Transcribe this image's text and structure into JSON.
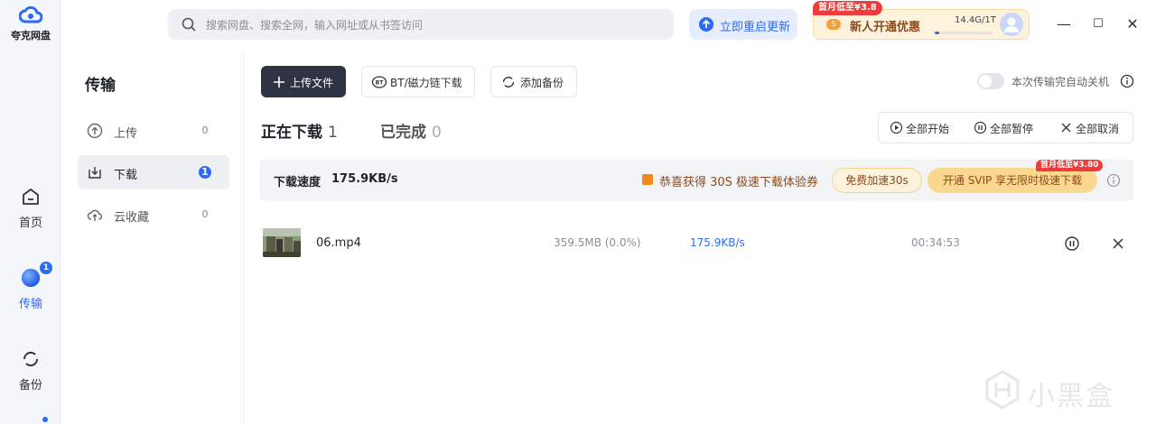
{
  "app": {
    "logo_text": "夸克网盘"
  },
  "rail": {
    "items": [
      {
        "label": "首页",
        "icon": "home-icon"
      },
      {
        "label": "传输",
        "icon": "transfer-icon",
        "badge": "1"
      },
      {
        "label": "备份",
        "icon": "backup-icon"
      }
    ]
  },
  "topbar": {
    "search_placeholder": "搜索网盘、搜索全网，输入网址或从书签访问",
    "restart_label": "立即重启更新",
    "promo_tag": "首月低至¥3.8",
    "promo_label": "新人开通优惠",
    "promo_coin": "S",
    "quota": "14.4G/1T",
    "quota_fraction": 0.0144
  },
  "window_controls": [
    "—",
    "☐",
    "✕"
  ],
  "side": {
    "title": "传输",
    "items": [
      {
        "label": "上传",
        "count": "0"
      },
      {
        "label": "下载",
        "count": "1"
      },
      {
        "label": "云收藏",
        "count": "0"
      }
    ]
  },
  "toolbar": {
    "upload_label": "上传文件",
    "bt_label": "BT/磁力链下载",
    "backup_label": "添加备份",
    "auto_shutdown_label": "本次传输完自动关机",
    "auto_shutdown_on": false
  },
  "tabs": [
    {
      "label": "正在下载",
      "count": "1"
    },
    {
      "label": "已完成",
      "count": "0"
    }
  ],
  "actions": {
    "start_all": "全部开始",
    "pause_all": "全部暂停",
    "cancel_all": "全部取消"
  },
  "speedbar": {
    "label": "下载速度",
    "value": "175.9KB/s",
    "gift_text": "恭喜获得 30S 极速下载体验券",
    "free_button": "免费加速30s",
    "svip_button": "开通 SVIP 享无限时极速下载",
    "svip_tag": "首月低至¥3.80"
  },
  "downloads": [
    {
      "name": "06.mp4",
      "size": "359.5MB (0.0%)",
      "speed": "175.9KB/s",
      "time": "00:34:53"
    }
  ],
  "watermark": "小黑盒",
  "colors": {
    "accent": "#2c6bf6",
    "dark_button": "#2e3443",
    "promo_bg": "#fdf3dc",
    "svip_bg": "#fbd88d",
    "tag_red": "#ee3c3c"
  }
}
